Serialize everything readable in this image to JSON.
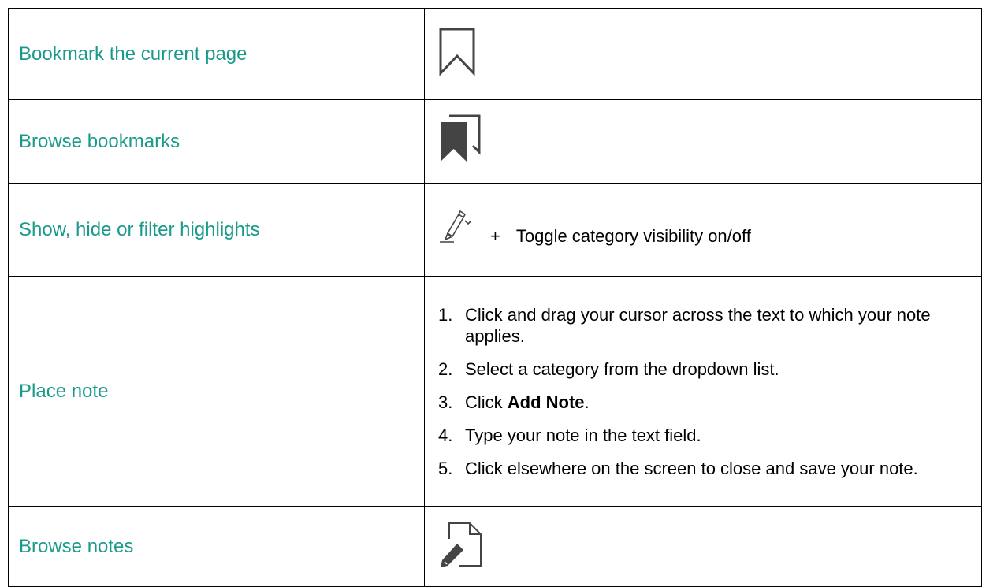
{
  "rows": [
    {
      "label": "Bookmark the current page",
      "icon": "bookmark-outline-icon"
    },
    {
      "label": "Browse bookmarks",
      "icon": "bookmarks-browse-icon"
    },
    {
      "label": "Show, hide or filter highlights",
      "icon": "highlighter-dropdown-icon",
      "plus": "+",
      "text": "Toggle category visibility on/off"
    },
    {
      "label": "Place note",
      "steps": [
        {
          "num": "1.",
          "text": "Click and drag your cursor across the text to which your note applies."
        },
        {
          "num": "2.",
          "text": "Select a category from the dropdown list."
        },
        {
          "num": "3.",
          "pre": "Click ",
          "bold": "Add Note",
          "post": "."
        },
        {
          "num": "4.",
          "text": "Type your note in the text field."
        },
        {
          "num": "5.",
          "text": "Click elsewhere on the screen to close and save your note."
        }
      ]
    },
    {
      "label": "Browse notes",
      "icon": "note-pencil-icon"
    }
  ],
  "colors": {
    "label": "#1a9a8a",
    "icon": "#444444",
    "border": "#000000"
  }
}
